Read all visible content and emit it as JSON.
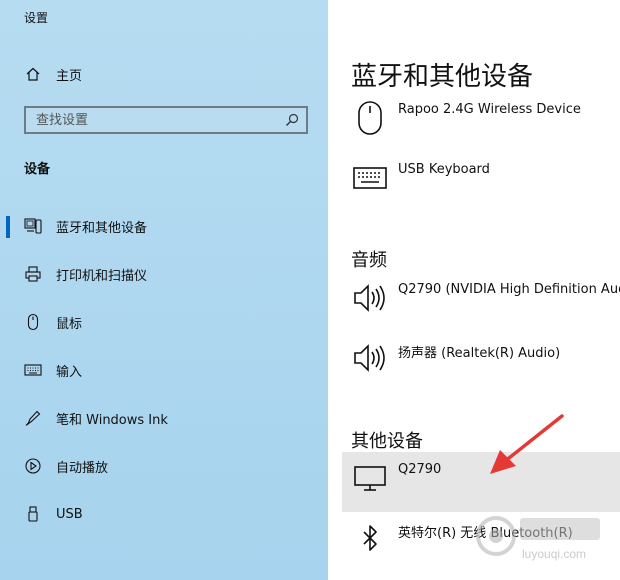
{
  "app": {
    "title": "设置"
  },
  "sidebar": {
    "home_label": "主页",
    "search": {
      "placeholder": "查找设置"
    },
    "section_heading": "设备",
    "items": [
      {
        "label": "蓝牙和其他设备",
        "icon": "bluetooth-devices-icon",
        "selected": true
      },
      {
        "label": "打印机和扫描仪",
        "icon": "printer-icon"
      },
      {
        "label": "鼠标",
        "icon": "mouse-icon"
      },
      {
        "label": "输入",
        "icon": "keyboard-icon"
      },
      {
        "label": "笔和 Windows Ink",
        "icon": "pen-icon"
      },
      {
        "label": "自动播放",
        "icon": "autoplay-icon"
      },
      {
        "label": "USB",
        "icon": "usb-icon"
      }
    ]
  },
  "main": {
    "title": "蓝牙和其他设备",
    "input_devices": [
      {
        "name": "Rapoo 2.4G Wireless Device",
        "icon": "mouse-icon"
      },
      {
        "name": "USB Keyboard",
        "icon": "keyboard-icon"
      }
    ],
    "audio": {
      "heading": "音频",
      "devices": [
        {
          "name": "Q2790 (NVIDIA High Definition Aud",
          "icon": "speaker-icon"
        },
        {
          "name": "扬声器 (Realtek(R) Audio)",
          "icon": "speaker-icon"
        }
      ]
    },
    "other": {
      "heading": "其他设备",
      "devices": [
        {
          "name": "Q2790",
          "icon": "monitor-icon",
          "selected": true
        },
        {
          "name": "英特尔(R) 无线 Bluetooth(R)",
          "icon": "bluetooth-icon"
        }
      ]
    }
  },
  "annotation": {
    "color": "#e53935"
  },
  "colors": {
    "sidebar_bg": "#b6dcf1",
    "accent": "#0067c0",
    "selected_row": "#e6e6e6"
  },
  "watermark": {
    "text": "luyouqi.com"
  }
}
